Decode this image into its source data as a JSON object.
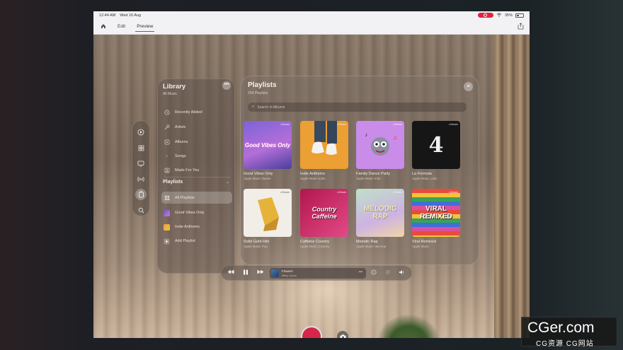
{
  "status_bar": {
    "time": "12:44 AM",
    "date": "Wed 16 Aug",
    "battery": "35%"
  },
  "toolbar": {
    "home_icon": "house-icon",
    "tabs": [
      {
        "label": "Edit"
      },
      {
        "label": "Preview"
      }
    ],
    "active_tab": "Preview",
    "share_icon": "share-icon"
  },
  "ornament": {
    "items": [
      "play-circle-icon",
      "grid-icon",
      "tv-icon",
      "radio-waves-icon",
      "library-icon",
      "search-icon"
    ],
    "active_index": 4
  },
  "library": {
    "title": "Library",
    "subtitle": "All Music",
    "items": [
      {
        "label": "Recently Added",
        "icon": "clock-icon"
      },
      {
        "label": "Artists",
        "icon": "mic-icon"
      },
      {
        "label": "Albums",
        "icon": "album-icon"
      },
      {
        "label": "Songs",
        "icon": "note-icon"
      },
      {
        "label": "Made For You",
        "icon": "person-icon"
      }
    ],
    "section": "Playlists",
    "playlists": [
      {
        "label": "All Playlists",
        "icon": "grid-icon",
        "selected": true
      },
      {
        "label": "Good Vibes Only",
        "icon": "thumbnail"
      },
      {
        "label": "Indie Anthems",
        "icon": "thumbnail"
      },
      {
        "label": "Add Playlist",
        "icon": "plus-icon"
      }
    ]
  },
  "playlists_panel": {
    "title": "Playlists",
    "count": "254 Playlists",
    "search_placeholder": "Search in Albums",
    "cards": [
      {
        "name": "Good Vibes Only",
        "sub": "Apple Music Dance",
        "art_text": "Good Vibes Only",
        "colors": [
          "#6b57c9",
          "#d07ad6"
        ]
      },
      {
        "name": "Indie Anthems",
        "sub": "Apple Music Indie",
        "art_text": "",
        "colors": [
          "#e8a23a",
          "#f0c14a"
        ]
      },
      {
        "name": "Family Dance Party",
        "sub": "Apple Music Kids",
        "art_text": "",
        "colors": [
          "#c58be8",
          "#e0b7f2"
        ]
      },
      {
        "name": "La Formula",
        "sub": "Apple Music Latin",
        "art_text": "4",
        "colors": [
          "#1a1a1a",
          "#2a2a2a"
        ]
      },
      {
        "name": "Solid Gold Hits",
        "sub": "Apple Music Pop",
        "art_text": "",
        "colors": [
          "#f2f0ec",
          "#e4dfd6"
        ]
      },
      {
        "name": "Caffeine Country",
        "sub": "Apple Music Country",
        "art_text": "Country Caffeine",
        "colors": [
          "#c2185b",
          "#f06292"
        ]
      },
      {
        "name": "Melodic Rap",
        "sub": "Apple Music Hip-Hop",
        "art_text": "MELODIC RAP",
        "colors": [
          "#a8c9b8",
          "#d7c2e6"
        ]
      },
      {
        "name": "Viral Remixed",
        "sub": "Apple Music",
        "art_text": "VIRAL REMIXED",
        "colors": [
          "#e94f37",
          "#3fa34d"
        ]
      }
    ]
  },
  "player": {
    "title": "Flowers",
    "artist": "Miley Cyrus",
    "more": "•••"
  },
  "watermark": {
    "line1": "CGer.com",
    "line2": "CG资源 CG网站"
  }
}
